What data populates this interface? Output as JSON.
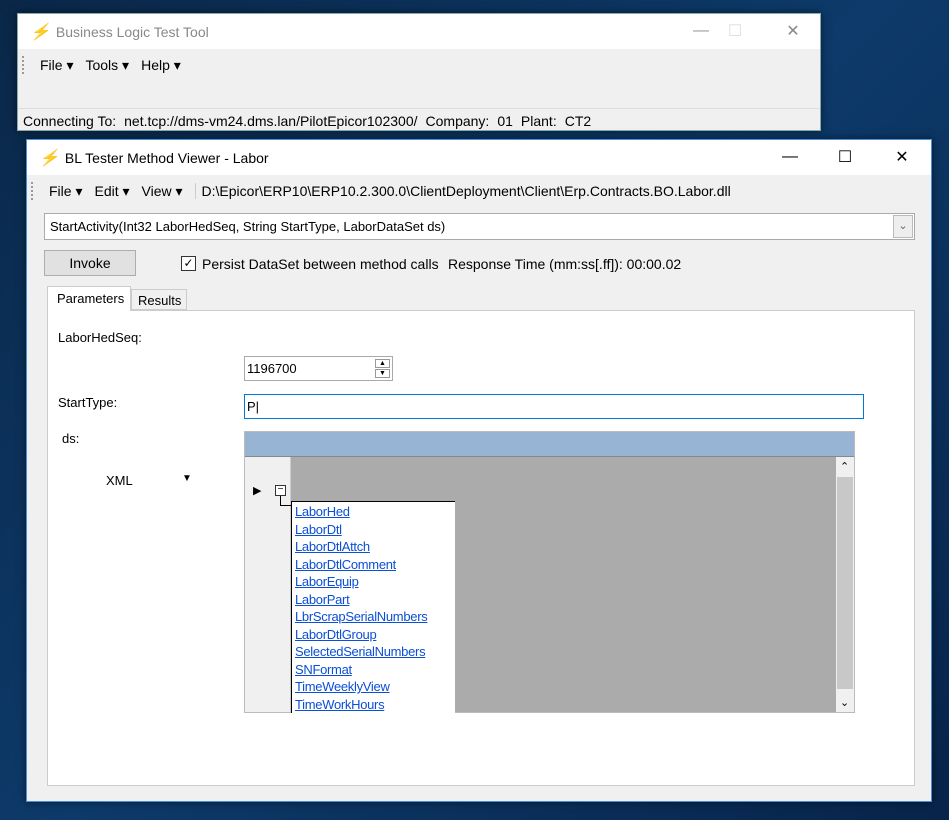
{
  "main_window": {
    "title": "Business Logic Test Tool",
    "menu": [
      "File",
      "Tools",
      "Help"
    ],
    "status": {
      "connecting_label": "Connecting To:",
      "connecting_value": "net.tcp://dms-vm24.dms.lan/PilotEpicor102300/",
      "company_label": "Company:",
      "company_value": "01",
      "plant_label": "Plant:",
      "plant_value": "CT2"
    }
  },
  "viewer": {
    "title": "BL Tester Method Viewer - Labor",
    "menu": [
      "File",
      "Edit",
      "View"
    ],
    "path": "D:\\Epicor\\ERP10\\ERP10.2.300.0\\ClientDeployment\\Client\\Erp.Contracts.BO.Labor.dll",
    "method": "StartActivity(Int32 LaborHedSeq, String StartType, LaborDataSet ds)",
    "invoke_label": "Invoke",
    "persist_label": "Persist DataSet between method calls",
    "persist_checked": true,
    "response_time": "Response Time (mm:ss[.ff]): 00:00.02",
    "tabs": [
      "Parameters",
      "Results"
    ],
    "params": {
      "laborhedseq_label": "LaborHedSeq:",
      "laborhedseq_value": "1196700",
      "starttype_label": "StartType:",
      "starttype_value": "P",
      "ds_label": "ds:",
      "ds_format": "XML"
    },
    "tables": [
      "LaborHed",
      "LaborDtl",
      "LaborDtlAttch",
      "LaborDtlComment",
      "LaborEquip",
      "LaborPart",
      "LbrScrapSerialNumbers",
      "LaborDtlGroup",
      "SelectedSerialNumbers",
      "SNFormat",
      "TimeWeeklyView",
      "TimeWorkHours"
    ]
  }
}
